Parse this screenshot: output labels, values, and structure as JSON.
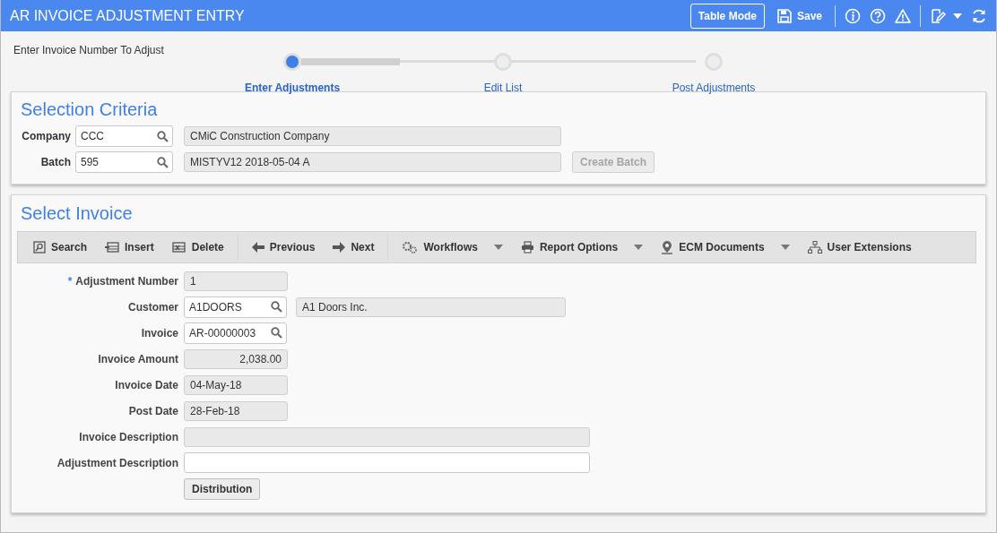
{
  "header": {
    "title": "AR INVOICE ADJUSTMENT ENTRY",
    "buttons": [
      {
        "label": "Table Mode",
        "kind": "outlined"
      },
      {
        "label": "Save",
        "kind": "save"
      }
    ]
  },
  "instruction": "Enter Invoice Number To Adjust",
  "stepper": {
    "level": 0.25,
    "steps": [
      {
        "label": "Enter Adjustments",
        "selected": true
      },
      {
        "label": "Edit List",
        "selected": false
      },
      {
        "label": "Post Adjustments",
        "selected": false
      }
    ]
  },
  "selection_criteria": {
    "title": "Selection Criteria",
    "rows": [
      {
        "label": "Company",
        "value": "CCC",
        "description": "CMiC Construction Company"
      },
      {
        "label": "Batch",
        "value": "595",
        "description": "MISTYV12 2018-05-04 A",
        "button": {
          "label": "Create Batch",
          "disabled": true
        }
      }
    ]
  },
  "select_invoice": {
    "title": "Select Invoice",
    "toolbar": [
      {
        "label": "Search",
        "has_menu": false
      },
      {
        "label": "Insert",
        "has_menu": false
      },
      {
        "label": "Delete",
        "has_menu": false
      },
      {
        "label": "Previous",
        "has_menu": false
      },
      {
        "label": "Next",
        "has_menu": false
      },
      {
        "label": "Workflows",
        "has_menu": true
      },
      {
        "label": "Report Options",
        "has_menu": true
      },
      {
        "label": "ECM Documents",
        "has_menu": true
      },
      {
        "label": "User Extensions",
        "has_menu": false
      }
    ],
    "fields": [
      {
        "label": "Adjustment Number",
        "kind": "readonly",
        "value": "1",
        "required_mark": "*"
      },
      {
        "label": "Customer",
        "kind": "lookup",
        "value": "A1DOORS",
        "description": "A1 Doors Inc."
      },
      {
        "label": "Invoice",
        "kind": "lookup",
        "value": "AR-00000003"
      },
      {
        "label": "Invoice Amount",
        "kind": "readonly-number",
        "value": "2,038.00"
      },
      {
        "label": "Invoice Date",
        "kind": "readonly",
        "value": "04-May-18"
      },
      {
        "label": "Post Date",
        "kind": "readonly",
        "value": "28-Feb-18"
      },
      {
        "label": "Invoice Description",
        "kind": "readonly-wide"
      },
      {
        "label": "Adjustment Description",
        "kind": "input-wide"
      }
    ],
    "button": {
      "label": "Distribution"
    }
  }
}
